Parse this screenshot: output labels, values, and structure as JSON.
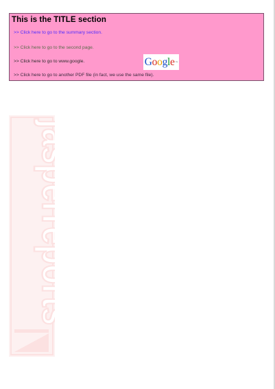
{
  "title_section": {
    "title": "This is the TITLE section",
    "links": [
      ">> Click here to go to the summary section.",
      ">> Click here to go to the second page.",
      ">> Click here to go to www.google.",
      ">> Click here to go to another PDF file (in fact, we use the same file)."
    ]
  },
  "logos": {
    "google": [
      "G",
      "o",
      "o",
      "g",
      "l",
      "e"
    ],
    "watermark": "jasperreports"
  },
  "colors": {
    "title_background": "#ff99cc",
    "border": "#7a4f6b",
    "watermark": "#fbc9c9"
  }
}
